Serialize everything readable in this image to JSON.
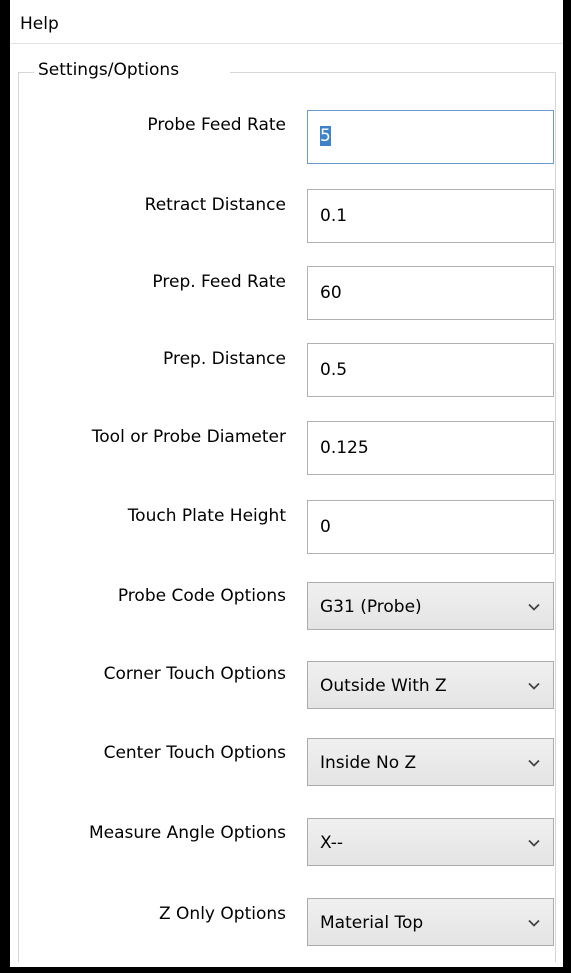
{
  "menu": {
    "help": "Help"
  },
  "group": {
    "title": "Settings/Options"
  },
  "fields": [
    {
      "label": "Probe Feed Rate",
      "value": "5"
    },
    {
      "label": "Retract Distance",
      "value": "0.1"
    },
    {
      "label": "Prep. Feed Rate",
      "value": "60"
    },
    {
      "label": "Prep. Distance",
      "value": "0.5"
    },
    {
      "label": "Tool or Probe Diameter",
      "value": "0.125"
    },
    {
      "label": "Touch Plate Height",
      "value": "0"
    }
  ],
  "dropdowns": [
    {
      "label": "Probe Code Options",
      "value": "G31 (Probe)"
    },
    {
      "label": "Corner Touch Options",
      "value": "Outside With Z"
    },
    {
      "label": "Center Touch Options",
      "value": "Inside No Z"
    },
    {
      "label": "Measure Angle Options",
      "value": "X--"
    },
    {
      "label": "Z Only Options",
      "value": "Material Top"
    }
  ],
  "icons": {
    "dropdown_arrow": "chevron-down-icon"
  },
  "colors": {
    "selection": "#3f82c8",
    "focus_border": "#6f9bcc"
  }
}
